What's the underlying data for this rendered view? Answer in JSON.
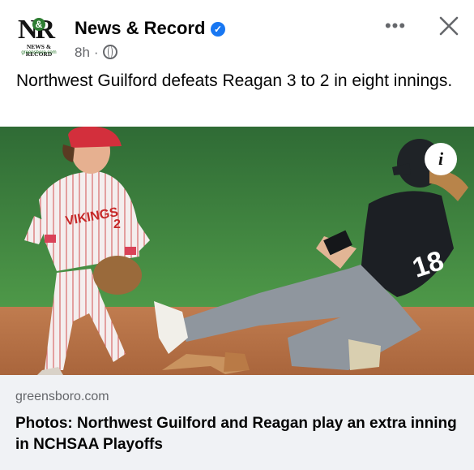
{
  "header": {
    "logo": {
      "mark": "NR",
      "amp": "&",
      "name": "NEWS & RECORD",
      "site": "greensboro.com"
    },
    "page_name": "News & Record",
    "verified_icon": "verified-badge-icon",
    "time": "8h",
    "separator": "·",
    "audience_icon": "globe-icon",
    "more_icon": "more-horizontal-icon",
    "more_label": "•••",
    "close_icon": "close-icon"
  },
  "post": {
    "text": "Northwest Guilford defeats Reagan 3 to 2 in eight innings."
  },
  "photo": {
    "info_label": "i",
    "infielder_jersey_text": "VIKINGS",
    "infielder_number": "2",
    "runner_number": "18"
  },
  "link_preview": {
    "domain": "greensboro.com",
    "title": "Photos: Northwest Guilford and Reagan play an extra inning in NCHSAA Playoffs"
  },
  "colors": {
    "accent": "#1877f2",
    "secondary_text": "#65676b",
    "preview_bg": "#f0f2f5",
    "grass": "#3f8a3e",
    "dirt": "#b8754a"
  }
}
